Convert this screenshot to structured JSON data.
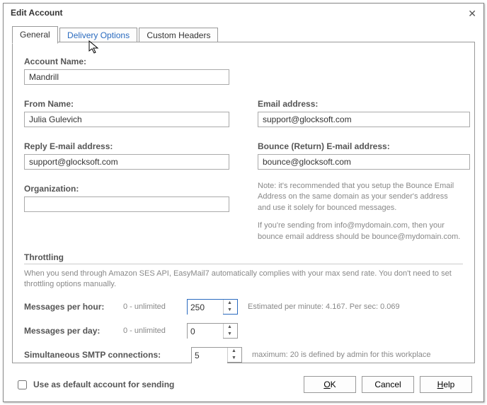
{
  "title": "Edit Account",
  "tabs": {
    "general": "General",
    "delivery": "Delivery Options",
    "headers": "Custom Headers"
  },
  "labels": {
    "accountName": "Account Name:",
    "fromName": "From Name:",
    "email": "Email address:",
    "reply": "Reply E-mail address:",
    "bounce": "Bounce (Return) E-mail address:",
    "org": "Organization:",
    "throttling": "Throttling",
    "mph": "Messages per hour:",
    "mpd": "Messages per day:",
    "smtp": "Simultaneous SMTP connections:",
    "unlimited": "0 - unlimited",
    "defaultChk": "Use as default account for sending"
  },
  "values": {
    "accountName": "Mandrill",
    "fromName": "Julia Gulevich",
    "email": "support@glocksoft.com",
    "reply": "support@glocksoft.com",
    "bounce": "bounce@glocksoft.com",
    "org": "",
    "mph": "250",
    "mpd": "0",
    "smtp": "5"
  },
  "notes": {
    "bounceNote1": "Note: it's recommended that you setup the Bounce Email Address on the same domain as your sender's address and use it solely for bounced messages.",
    "bounceNote2": "If you're sending from info@mydomain.com, then your bounce email address should be bounce@mydomain.com.",
    "throttleDesc": "When you send through Amazon SES API, EasyMail7 automatically complies with your max send rate. You don't need to set throttling options manually.",
    "estimated": "Estimated per minute: 4.167. Per sec: 0.069",
    "smtpMax": "maximum: 20 is defined by admin for this workplace"
  },
  "buttons": {
    "ok": "OK",
    "cancel": "Cancel",
    "help": "Help"
  }
}
